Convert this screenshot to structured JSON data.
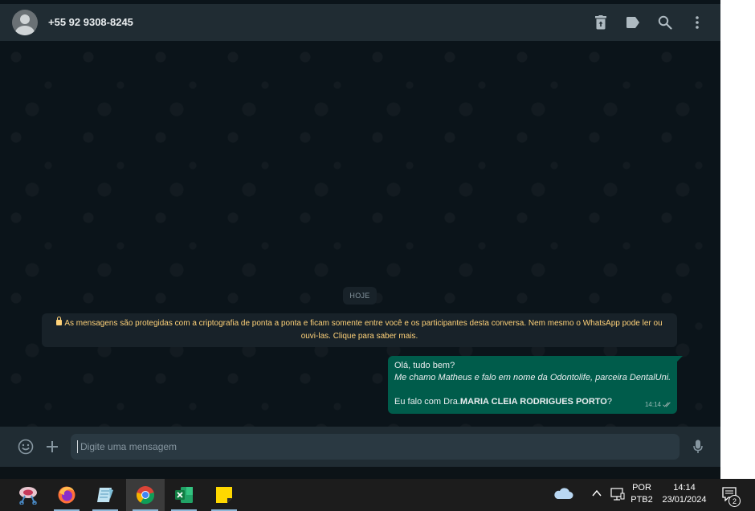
{
  "header": {
    "contact_name": "+55 92 9308-8245",
    "icons": [
      "archive-icon",
      "label-icon",
      "search-icon",
      "menu-icon"
    ]
  },
  "messages": {
    "date_chip": "HOJE",
    "encryption_notice": "As mensagens são protegidas com a criptografia de ponta a ponta e ficam somente entre você e os participantes desta conversa. Nem mesmo o WhatsApp pode ler ou ouvi-las. Clique para saber mais.",
    "outgoing": {
      "line1": "Olá, tudo bem?",
      "line2": "Me chamo Matheus e falo em nome da Odontolife, parceira DentalUni.",
      "line3_prefix": "Eu falo com Dra.",
      "line3_bold": "MARIA CLEIA RODRIGUES PORTO",
      "line3_suffix": "?",
      "time": "14:14"
    }
  },
  "footer": {
    "input_placeholder": "Digite uma mensagem"
  },
  "taskbar": {
    "apps": [
      "snipping-tool-icon",
      "firefox-icon",
      "notepad-icon",
      "chrome-icon",
      "excel-icon",
      "sticky-notes-icon"
    ],
    "language_top": "POR",
    "language_bottom": "PTB2",
    "time": "14:14",
    "date": "23/01/2024",
    "notification_count": "2"
  },
  "colors": {
    "header_bg": "#202c33",
    "chat_bg": "#0b141a",
    "outgoing_bubble": "#005c4b",
    "notice_text": "#ffd279"
  }
}
